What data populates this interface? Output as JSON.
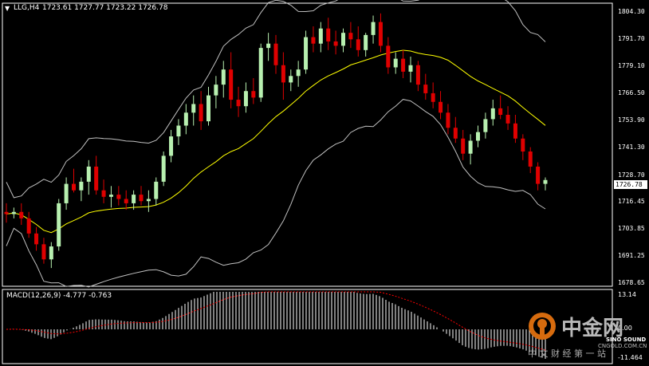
{
  "header": {
    "menu_arrow": "triangle-down-icon",
    "symbol": "LLG,H4",
    "ohlc": "1723.61 1727.77 1723.22 1726.78"
  },
  "price_axis": {
    "labels": [
      "1804.30",
      "1791.70",
      "1779.10",
      "1766.50",
      "1753.90",
      "1741.30",
      "1728.70",
      "1716.45",
      "1703.85",
      "1691.25",
      "1678.65"
    ],
    "current_price": "1726.78"
  },
  "macd": {
    "label": "MACD(12,26,9) -4.777 -0.763",
    "axis_top": "13.14",
    "axis_mid": "0.00",
    "axis_bottom": "-11.464"
  },
  "watermark": {
    "brand": "中金网",
    "url": "CNGOLD.COM.CN",
    "tagline": "中 文 财 经 第 一 站",
    "sound": "SINO SOUND"
  },
  "colors": {
    "background": "#000000",
    "bull": "#b8f0b0",
    "bear": "#e00000",
    "band": "#c0c0c0",
    "ma": "#ffff00",
    "macd_hist": "#ffffff",
    "macd_signal": "#ff0000"
  },
  "chart_data": {
    "type": "candlestick",
    "symbol": "LLG",
    "timeframe": "H4",
    "ylim": [
      1678.65,
      1808
    ],
    "ohlc": [
      [
        1712,
        1716,
        1707,
        1711
      ],
      [
        1711,
        1714,
        1709,
        1712
      ],
      [
        1712,
        1716,
        1706,
        1709
      ],
      [
        1709,
        1712,
        1700,
        1702
      ],
      [
        1702,
        1705,
        1694,
        1697
      ],
      [
        1697,
        1700,
        1688,
        1690
      ],
      [
        1690,
        1698,
        1686,
        1696
      ],
      [
        1696,
        1718,
        1694,
        1716
      ],
      [
        1716,
        1728,
        1713,
        1725
      ],
      [
        1725,
        1732,
        1721,
        1722
      ],
      [
        1722,
        1728,
        1717,
        1726
      ],
      [
        1726,
        1736,
        1720,
        1733
      ],
      [
        1733,
        1738,
        1720,
        1722
      ],
      [
        1722,
        1727,
        1716,
        1719
      ],
      [
        1719,
        1724,
        1714,
        1720
      ],
      [
        1720,
        1724,
        1715,
        1718
      ],
      [
        1718,
        1722,
        1713,
        1716
      ],
      [
        1716,
        1722,
        1713,
        1720
      ],
      [
        1720,
        1724,
        1715,
        1717
      ],
      [
        1717,
        1722,
        1712,
        1718
      ],
      [
        1718,
        1728,
        1715,
        1726
      ],
      [
        1726,
        1740,
        1724,
        1738
      ],
      [
        1738,
        1750,
        1735,
        1747
      ],
      [
        1747,
        1755,
        1743,
        1752
      ],
      [
        1752,
        1762,
        1748,
        1758
      ],
      [
        1758,
        1766,
        1752,
        1762
      ],
      [
        1762,
        1768,
        1750,
        1754
      ],
      [
        1754,
        1770,
        1752,
        1766
      ],
      [
        1766,
        1775,
        1760,
        1771
      ],
      [
        1771,
        1782,
        1765,
        1778
      ],
      [
        1778,
        1786,
        1760,
        1764
      ],
      [
        1764,
        1770,
        1756,
        1761
      ],
      [
        1761,
        1772,
        1758,
        1768
      ],
      [
        1768,
        1774,
        1762,
        1765
      ],
      [
        1765,
        1790,
        1763,
        1788
      ],
      [
        1788,
        1795,
        1782,
        1790
      ],
      [
        1790,
        1794,
        1776,
        1780
      ],
      [
        1780,
        1786,
        1764,
        1772
      ],
      [
        1772,
        1778,
        1768,
        1775
      ],
      [
        1775,
        1782,
        1770,
        1778
      ],
      [
        1778,
        1796,
        1776,
        1793
      ],
      [
        1793,
        1798,
        1786,
        1790
      ],
      [
        1790,
        1800,
        1786,
        1797
      ],
      [
        1797,
        1802,
        1787,
        1791
      ],
      [
        1791,
        1796,
        1785,
        1789
      ],
      [
        1789,
        1797,
        1786,
        1795
      ],
      [
        1795,
        1800,
        1788,
        1792
      ],
      [
        1792,
        1798,
        1784,
        1787
      ],
      [
        1787,
        1795,
        1784,
        1794
      ],
      [
        1794,
        1803,
        1790,
        1800
      ],
      [
        1800,
        1804,
        1786,
        1789
      ],
      [
        1789,
        1793,
        1776,
        1779
      ],
      [
        1779,
        1786,
        1776,
        1783
      ],
      [
        1783,
        1787,
        1774,
        1777
      ],
      [
        1777,
        1784,
        1772,
        1780
      ],
      [
        1780,
        1782,
        1768,
        1771
      ],
      [
        1771,
        1776,
        1764,
        1767
      ],
      [
        1767,
        1772,
        1760,
        1763
      ],
      [
        1763,
        1768,
        1755,
        1758
      ],
      [
        1758,
        1762,
        1748,
        1751
      ],
      [
        1751,
        1756,
        1744,
        1746
      ],
      [
        1746,
        1750,
        1736,
        1739
      ],
      [
        1739,
        1748,
        1734,
        1745
      ],
      [
        1745,
        1752,
        1742,
        1749
      ],
      [
        1749,
        1758,
        1746,
        1755
      ],
      [
        1755,
        1764,
        1752,
        1760
      ],
      [
        1760,
        1766,
        1755,
        1757
      ],
      [
        1757,
        1761,
        1750,
        1753
      ],
      [
        1753,
        1757,
        1744,
        1746
      ],
      [
        1746,
        1748,
        1736,
        1740
      ],
      [
        1740,
        1742,
        1730,
        1733
      ],
      [
        1733,
        1735,
        1722,
        1725
      ],
      [
        1725,
        1728,
        1722,
        1726.78
      ]
    ],
    "bollinger": "20-period bands shown",
    "moving_average": "shown in yellow",
    "macd_params": [
      12,
      26,
      9
    ],
    "macd_main": -4.777,
    "macd_signal": -0.763,
    "macd_ylim": [
      -11.464,
      13.14
    ]
  }
}
